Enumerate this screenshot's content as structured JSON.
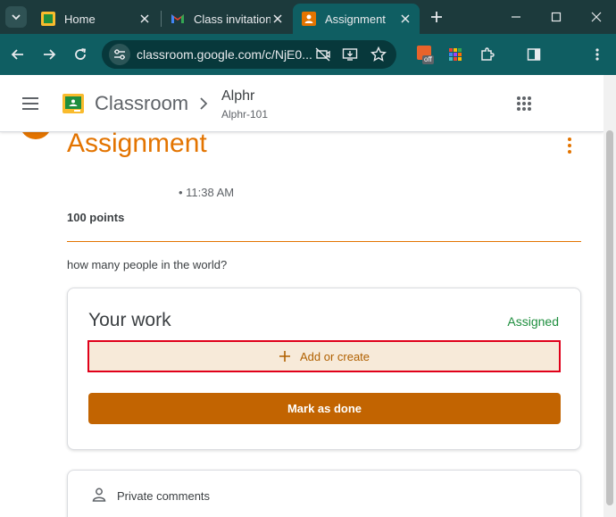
{
  "browser": {
    "tabs": [
      {
        "title": "Home",
        "active": false
      },
      {
        "title": "Class invitation",
        "active": false
      },
      {
        "title": "Assignment",
        "active": true
      }
    ],
    "address": {
      "url": "classroom.google.com/c/NjE0..."
    },
    "extension_badge": "off"
  },
  "header": {
    "app_name": "Classroom",
    "class_name": "Alphr",
    "class_section": "Alphr-101"
  },
  "assignment": {
    "title": "Assignment",
    "due_time": "• 11:38 AM",
    "points": "100 points",
    "instructions": "how many people in the world?"
  },
  "your_work": {
    "title": "Your work",
    "status": "Assigned",
    "add_label": "Add or create",
    "mark_done_label": "Mark as done"
  },
  "comments": {
    "label": "Private comments"
  },
  "colors": {
    "accent": "#e37400",
    "status_green": "#1e8e3e",
    "highlight_red": "#e0001a",
    "browser_frame": "#1c3a3c",
    "toolbar": "#0f5e62"
  }
}
